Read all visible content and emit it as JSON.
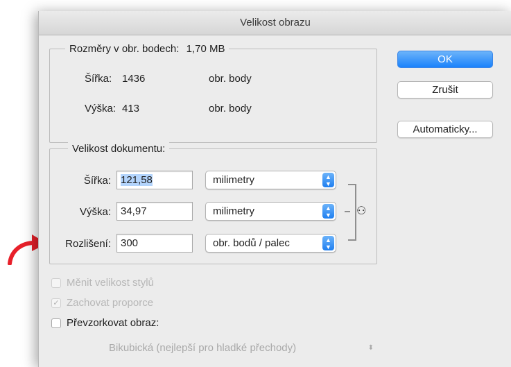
{
  "dialog": {
    "title": "Velikost obrazu"
  },
  "pixel_dimensions": {
    "label": "Rozměry v obr. bodech:",
    "size": "1,70 MB",
    "width": {
      "label": "Šířka:",
      "value": "1436",
      "unit": "obr. body"
    },
    "height": {
      "label": "Výška:",
      "value": "413",
      "unit": "obr. body"
    }
  },
  "document_size": {
    "label": "Velikost dokumentu:",
    "width": {
      "label": "Šířka:",
      "value": "121,58",
      "unit": "milimetry"
    },
    "height": {
      "label": "Výška:",
      "value": "34,97",
      "unit": "milimetry"
    },
    "resolution": {
      "label": "Rozlišení:",
      "value": "300",
      "unit": "obr. bodů / palec"
    }
  },
  "buttons": {
    "ok": "OK",
    "cancel": "Zrušit",
    "auto": "Automaticky..."
  },
  "options": {
    "scale_styles": {
      "label": "Měnit velikost stylů",
      "checked": false,
      "enabled": false
    },
    "constrain": {
      "label": "Zachovat proporce",
      "checked": true,
      "enabled": false
    },
    "resample": {
      "label": "Převzorkovat obraz:",
      "checked": false,
      "enabled": true
    },
    "method": "Bikubická (nejlepší pro hladké přechody)"
  },
  "colors": {
    "accent": "#1a82fb",
    "annotation": "#e8202a"
  },
  "icons": {
    "chain": "chain-link-icon",
    "annotation": "curved-arrow-icon"
  }
}
